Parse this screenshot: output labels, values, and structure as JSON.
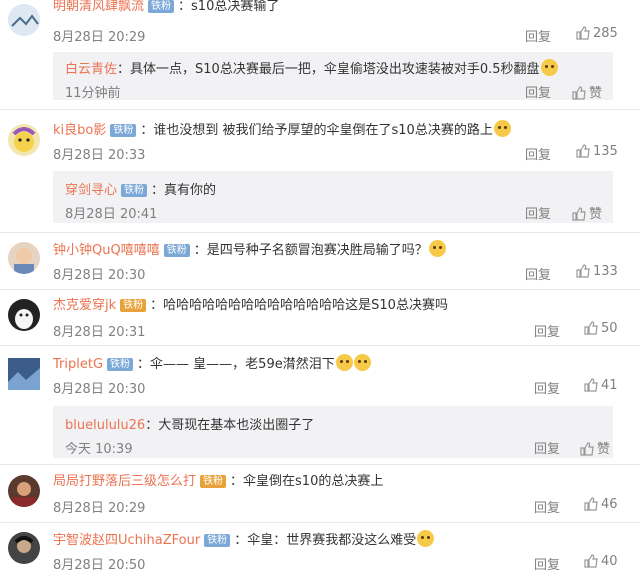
{
  "comments": [
    {
      "user": "明朝清风肆飘流",
      "badge": "铁粉",
      "sep": "：",
      "text": "s10总决赛输了",
      "time": "8月28日 20:29",
      "reply": "回复",
      "likes": "285",
      "sub": {
        "user": "白云青佐",
        "sep": "：",
        "text": "具体一点，S10总决赛最后一把，伞皇偷塔没出攻速装被对手0.5秒翻盘",
        "time": "11分钟前",
        "reply": "回复",
        "likes": "赞"
      }
    },
    {
      "user": "ki良bo影",
      "badge": "铁粉",
      "sep": "：",
      "text": "谁也没想到 被我们给予厚望的伞皇倒在了s10总决赛的路上",
      "time": "8月28日 20:33",
      "reply": "回复",
      "likes": "135",
      "sub": {
        "user": "穿剑寻心",
        "badge": "铁粉",
        "sep": "：",
        "text": "真有你的",
        "time": "8月28日 20:41",
        "reply": "回复",
        "likes": "赞"
      }
    },
    {
      "user": "钟小钟QuQ嘻嘻嘻",
      "badge": "铁粉",
      "sep": "：",
      "text": "是四号种子名额冒泡赛决胜局输了吗？",
      "time": "8月28日 20:30",
      "reply": "回复",
      "likes": "133"
    },
    {
      "user": "杰克爱穿jk",
      "badge": "铁粉",
      "sep": "：",
      "text": "哈哈哈哈哈哈哈哈哈哈哈哈哈哈这是S10总决赛吗",
      "time": "8月28日 20:31",
      "reply": "回复",
      "likes": "50"
    },
    {
      "user": "TripletG",
      "badge": "铁粉",
      "sep": "：",
      "text": "伞—— 皇——，老59e潸然泪下",
      "time": "8月28日 20:30",
      "reply": "回复",
      "likes": "41",
      "sub": {
        "user": "bluelululu26",
        "sep": "：",
        "text": "大哥现在基本也淡出圈子了",
        "time": "今天 10:39",
        "reply": "回复",
        "likes": "赞"
      }
    },
    {
      "user": "局局打野落后三级怎么打",
      "badge": "铁粉",
      "sep": "：",
      "text": "伞皇倒在s10的总决赛上",
      "time": "8月28日 20:29",
      "reply": "回复",
      "likes": "46"
    },
    {
      "user": "宇智波赵四UchihaZFour",
      "badge": "铁粉",
      "sep": "：",
      "text": "伞皇：世界赛我都没这么难受",
      "time": "8月28日 20:50",
      "reply": "回复",
      "likes": "40"
    }
  ]
}
